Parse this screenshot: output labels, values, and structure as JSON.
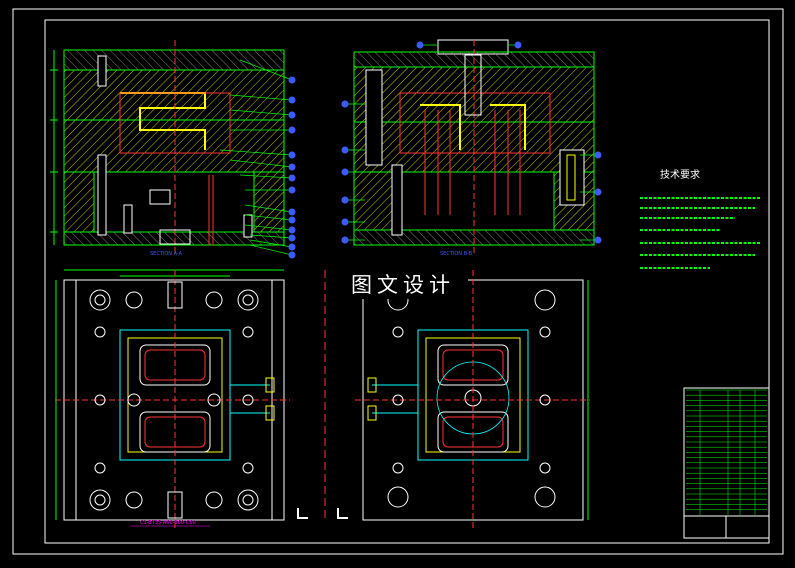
{
  "watermark": "图文设计",
  "views": {
    "section_a": "SECTION A-A",
    "section_b": "SECTION B-B",
    "plan_note": "C1-BT35-A60-B60-C60"
  },
  "technical_requirements": {
    "heading": "技术要求"
  },
  "colors": {
    "background": "#000000",
    "frame": "#ffffff",
    "outline": "#00ff00",
    "hatch": "#ffff00",
    "detail": "#ff3030",
    "balloon": "#3b5bff",
    "cyan": "#00ffff"
  },
  "icons": [
    "balloon-callout",
    "cooling-channel",
    "ejector-pin",
    "dimension-arrow"
  ]
}
